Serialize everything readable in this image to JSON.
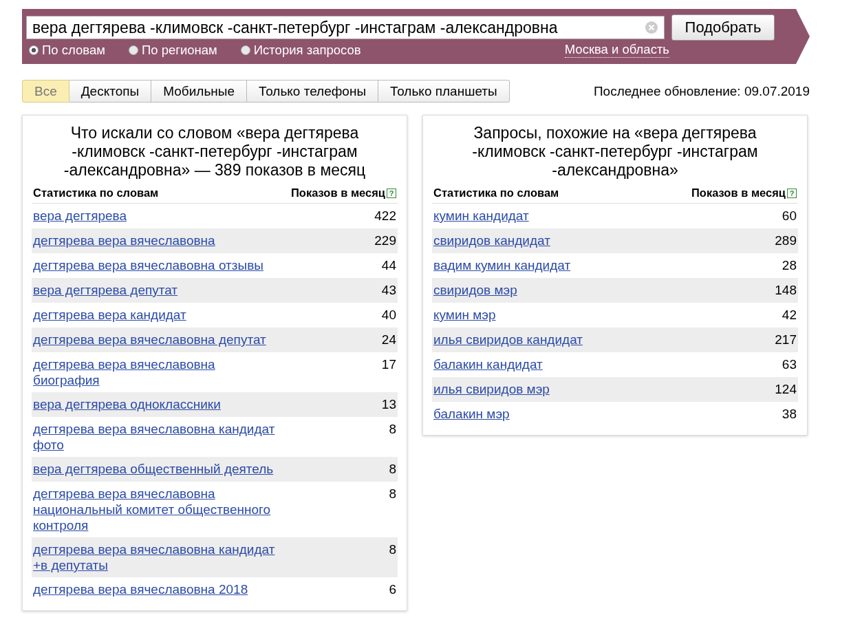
{
  "search": {
    "value": "вера дегтярева -климовск -санкт-петербург -инстаграм -александровна",
    "button": "Подобрать"
  },
  "modes": [
    {
      "label": "По словам",
      "selected": true
    },
    {
      "label": "По регионам",
      "selected": false
    },
    {
      "label": "История запросов",
      "selected": false
    }
  ],
  "region": "Москва и область",
  "tabs": [
    {
      "label": "Все",
      "selected": true
    },
    {
      "label": "Десктопы",
      "selected": false
    },
    {
      "label": "Мобильные",
      "selected": false
    },
    {
      "label": "Только телефоны",
      "selected": false
    },
    {
      "label": "Только планшеты",
      "selected": false
    }
  ],
  "last_update": "Последнее обновление: 09.07.2019",
  "panels": [
    {
      "title": "Что искали со словом «вера дегтярева -климовск -санкт-петербург -инстаграм -александровна» — 389 показов в месяц",
      "columns": [
        "Статистика по словам",
        "Показов в месяц"
      ],
      "help": "?",
      "rows": [
        {
          "phrase": "вера дегтярева",
          "count": "422"
        },
        {
          "phrase": "дегтярева вера вячеславовна",
          "count": "229"
        },
        {
          "phrase": "дегтярева вера вячеславовна отзывы",
          "count": "44"
        },
        {
          "phrase": "вера дегтярева депутат",
          "count": "43"
        },
        {
          "phrase": "дегтярева вера кандидат",
          "count": "40"
        },
        {
          "phrase": "дегтярева вера вячеславовна депутат",
          "count": "24"
        },
        {
          "phrase": "дегтярева вера вячеславовна биография",
          "count": "17"
        },
        {
          "phrase": "вера дегтярева одноклассники",
          "count": "13"
        },
        {
          "phrase": "дегтярева вера вячеславовна кандидат фото",
          "count": "8"
        },
        {
          "phrase": "вера дегтярева общественный деятель",
          "count": "8"
        },
        {
          "phrase": "дегтярева вера вячеславовна национальный комитет общественного контроля",
          "count": "8"
        },
        {
          "phrase": "дегтярева вера вячеславовна кандидат +в депутаты",
          "count": "8"
        },
        {
          "phrase": "дегтярева вера вячеславовна 2018",
          "count": "6"
        }
      ]
    },
    {
      "title": "Запросы, похожие на «вера дегтярева -климовск -санкт-петербург -инстаграм -александровна»",
      "columns": [
        "Статистика по словам",
        "Показов в месяц"
      ],
      "help": "?",
      "rows": [
        {
          "phrase": "кумин кандидат",
          "count": "60"
        },
        {
          "phrase": "свиридов кандидат",
          "count": "289"
        },
        {
          "phrase": "вадим кумин кандидат",
          "count": "28"
        },
        {
          "phrase": "свиридов мэр",
          "count": "148"
        },
        {
          "phrase": "кумин мэр",
          "count": "42"
        },
        {
          "phrase": "илья свиридов кандидат",
          "count": "217"
        },
        {
          "phrase": "балакин кандидат",
          "count": "63"
        },
        {
          "phrase": "илья свиридов мэр",
          "count": "124"
        },
        {
          "phrase": "балакин мэр",
          "count": "38"
        }
      ]
    }
  ]
}
